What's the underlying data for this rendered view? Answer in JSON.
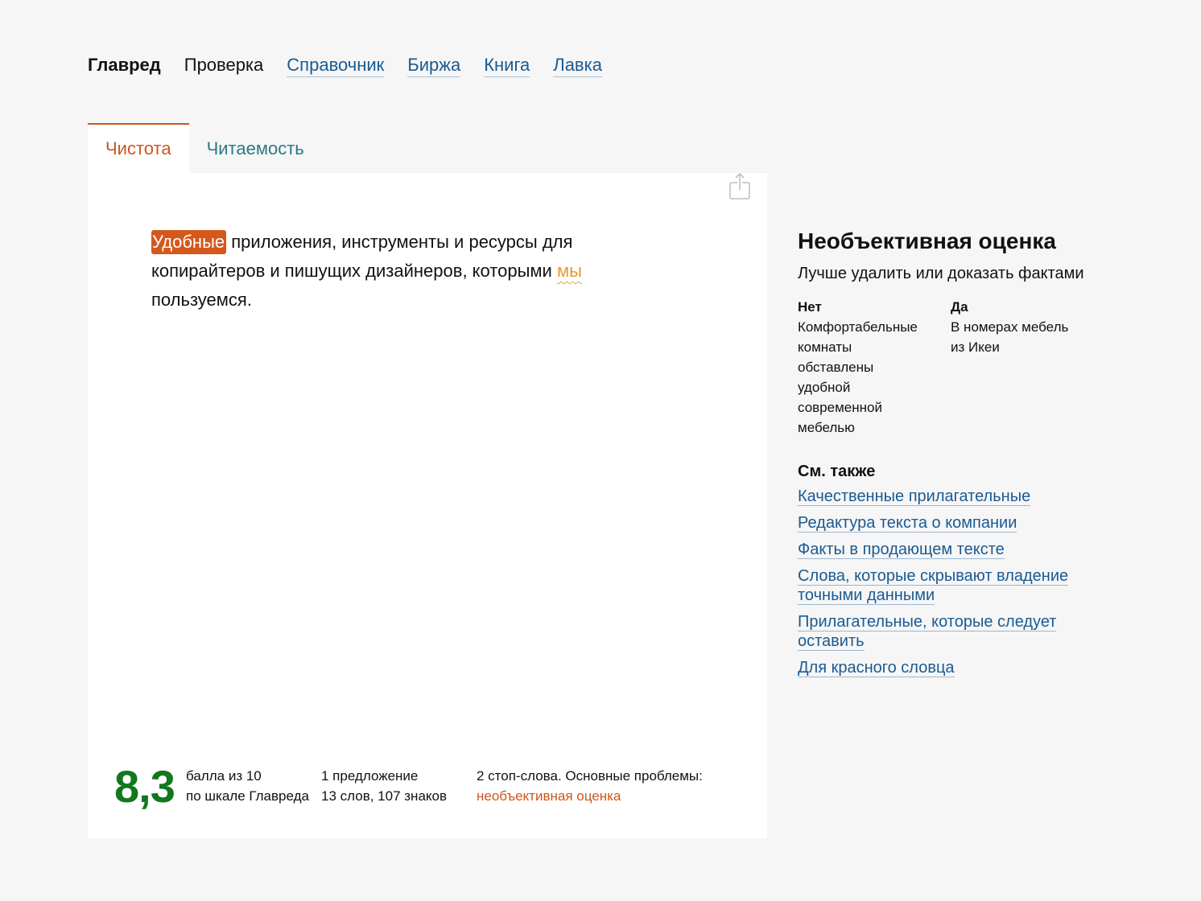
{
  "nav": {
    "brand": "Главред",
    "current": "Проверка",
    "links": [
      "Справочник",
      "Биржа",
      "Книга",
      "Лавка"
    ]
  },
  "tabs": {
    "active": "Чистота",
    "inactive": "Читаемость"
  },
  "editor": {
    "share_icon": "share-icon",
    "segments": {
      "word1": "Удобные",
      "text1": " приложения, инструменты и ресурсы для копирайтеров и пишущих дизайнеров, которыми ",
      "word2": "мы",
      "text2": " пользуемся."
    }
  },
  "stats": {
    "score": "8,3",
    "score_line1": "балла из 10",
    "score_line2": "по шкале Главреда",
    "count_line1": "1 предложение",
    "count_line2": "13 слов, 107 знаков",
    "problems_line1": "2 стоп-слова. Основные проблемы:",
    "problems_link": "необъективная оценка"
  },
  "sidebar": {
    "title": "Необъективная оценка",
    "subtitle": "Лучше удалить или доказать фактами",
    "no_label": "Нет",
    "no_text": "Комфортабельные\nкомнаты\nобставлены\nудобной\nсовременной\nмебелью",
    "yes_label": "Да",
    "yes_text": "В номерах мебель\nиз Икеи",
    "see_also_title": "См. также",
    "see_also": [
      "Качественные прилагательные",
      "Редактура текста о компании",
      "Факты в продающем тексте",
      "Слова, которые скрывают владение точными данными",
      "Прилагательные, которые следует оставить",
      "Для красного словца"
    ]
  },
  "colors": {
    "background": "#f6f6f6",
    "panel": "#ffffff",
    "accent_orange": "#cc561a",
    "link_blue": "#1a5a93",
    "tab_teal": "#2a7a80",
    "score_green": "#13771e",
    "weak_highlight": "#e8972a"
  }
}
